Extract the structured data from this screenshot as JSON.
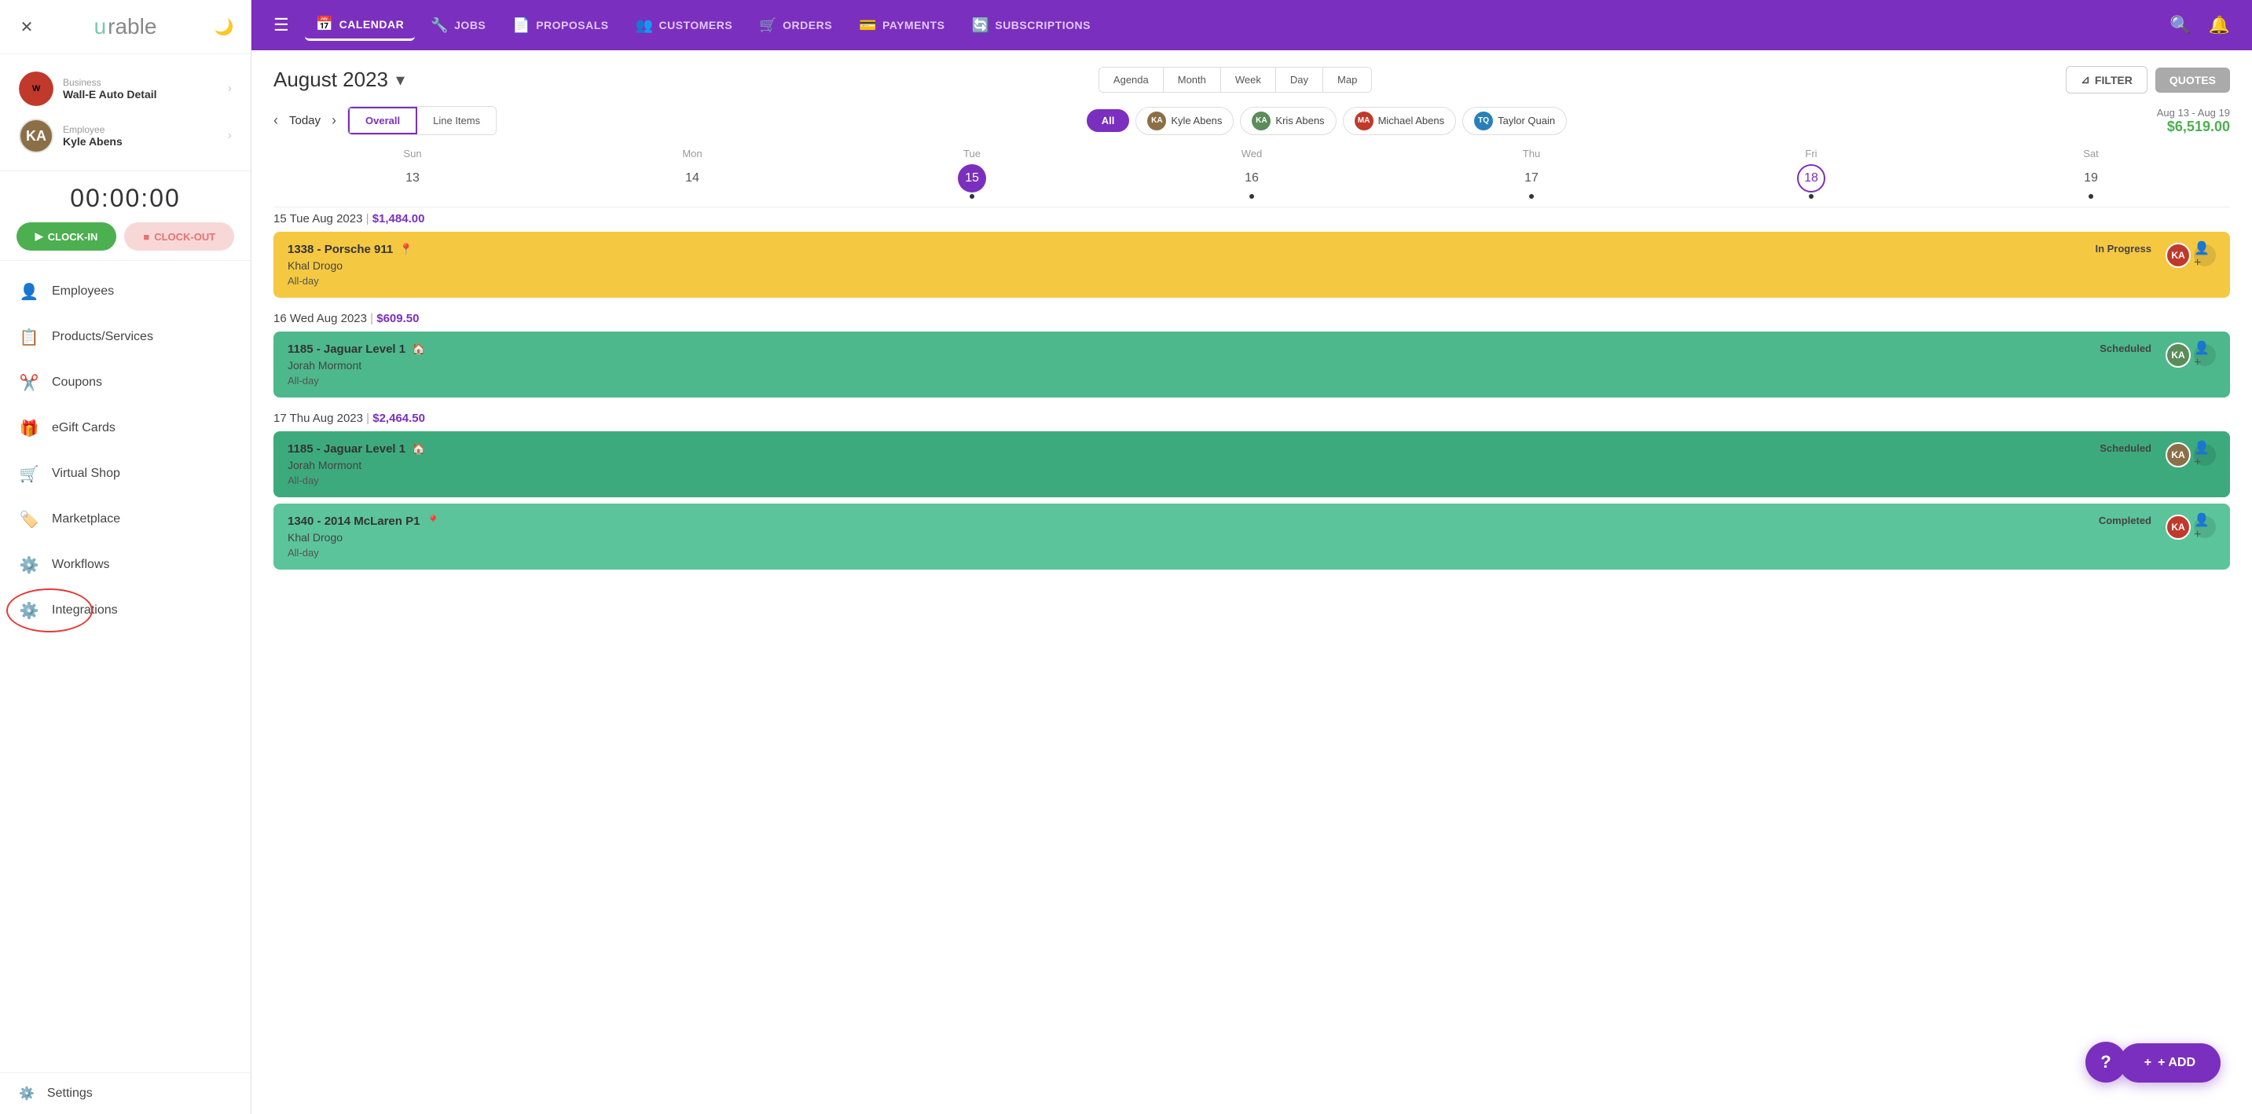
{
  "app": {
    "logo": "urable",
    "logo_u": "u",
    "logo_rest": "rable"
  },
  "sidebar": {
    "business_label": "Business",
    "business_name": "Wall-E Auto Detail",
    "employee_label": "Employee",
    "employee_name": "Kyle Abens",
    "timer": "00:00:00",
    "clock_in": "CLOCK-IN",
    "clock_out": "CLOCK-OUT",
    "nav_items": [
      {
        "label": "Employees",
        "icon": "👤"
      },
      {
        "label": "Products/Services",
        "icon": "📋"
      },
      {
        "label": "Coupons",
        "icon": "✂️"
      },
      {
        "label": "eGift Cards",
        "icon": "🎁"
      },
      {
        "label": "Virtual Shop",
        "icon": "🛒"
      },
      {
        "label": "Marketplace",
        "icon": "🏷️"
      },
      {
        "label": "Workflows",
        "icon": "⚙️"
      },
      {
        "label": "Integrations",
        "icon": "⚙️"
      }
    ],
    "settings_label": "Settings"
  },
  "topnav": {
    "items": [
      {
        "label": "CALENDAR",
        "icon": "📅",
        "active": true
      },
      {
        "label": "JOBS",
        "icon": "🔧"
      },
      {
        "label": "PROPOSALS",
        "icon": "📄"
      },
      {
        "label": "CUSTOMERS",
        "icon": "👥"
      },
      {
        "label": "ORDERS",
        "icon": "🛒"
      },
      {
        "label": "PAYMENTS",
        "icon": "💳"
      },
      {
        "label": "SUBSCRIPTIONS",
        "icon": "🔄"
      }
    ]
  },
  "calendar": {
    "month_year": "August  2023",
    "view_buttons": [
      "Agenda",
      "Month",
      "Week",
      "Day",
      "Map"
    ],
    "filter_label": "FILTER",
    "quotes_label": "QUOTES",
    "today_label": "Today",
    "tabs": [
      "Overall",
      "Line Items"
    ],
    "active_tab": "Overall",
    "filter_people": [
      {
        "label": "All",
        "active": true
      },
      {
        "label": "Kyle Abens",
        "color": "#8B6F47"
      },
      {
        "label": "Kris Abens",
        "color": "#5b8c5a"
      },
      {
        "label": "Michael Abens",
        "color": "#c0392b"
      },
      {
        "label": "Taylor Quain",
        "color": "#2980b9"
      }
    ],
    "date_range_label": "Aug 13 - Aug 19",
    "date_range_amount": "$6,519.00",
    "week_days": [
      "Sun",
      "Mon",
      "Tue",
      "Wed",
      "Thu",
      "Fri",
      "Sat"
    ],
    "week_dates": [
      {
        "num": "13",
        "state": "normal",
        "dot": false
      },
      {
        "num": "14",
        "state": "normal",
        "dot": false
      },
      {
        "num": "15",
        "state": "today",
        "dot": true
      },
      {
        "num": "16",
        "state": "normal",
        "dot": true
      },
      {
        "num": "17",
        "state": "normal",
        "dot": true
      },
      {
        "num": "18",
        "state": "selected",
        "dot": true
      },
      {
        "num": "19",
        "state": "normal",
        "dot": true
      }
    ],
    "date_sections": [
      {
        "header": "15 Tue Aug 2023",
        "amount": "$1,484.00",
        "events": [
          {
            "id": "1338",
            "title": "1338 - Porsche 911",
            "customer": "Khal Drogo",
            "time": "All-day",
            "status": "In Progress",
            "color": "yellow",
            "has_location": true,
            "avatars": [
              "#c0392b",
              "#8B6F47"
            ]
          }
        ]
      },
      {
        "header": "16 Wed Aug 2023",
        "amount": "$609.50",
        "events": [
          {
            "id": "1185",
            "title": "1185 - Jaguar Level 1",
            "customer": "Jorah Mormont",
            "time": "All-day",
            "status": "Scheduled",
            "color": "green",
            "has_location": true,
            "avatars": [
              "#c0392b",
              "#2980b9"
            ]
          }
        ]
      },
      {
        "header": "17 Thu Aug 2023",
        "amount": "$2,464.50",
        "events": [
          {
            "id": "1185b",
            "title": "1185 - Jaguar Level 1",
            "customer": "Jorah Mormont",
            "time": "All-day",
            "status": "Scheduled",
            "color": "green2",
            "has_location": true,
            "avatars": [
              "#8B6F47"
            ]
          },
          {
            "id": "1340",
            "title": "1340 - 2014 McLaren P1",
            "customer": "Khal Drogo",
            "time": "All-day",
            "status": "Completed",
            "color": "green3",
            "has_location": true,
            "avatars": [
              "#c0392b"
            ]
          }
        ]
      }
    ],
    "add_label": "+ ADD"
  }
}
